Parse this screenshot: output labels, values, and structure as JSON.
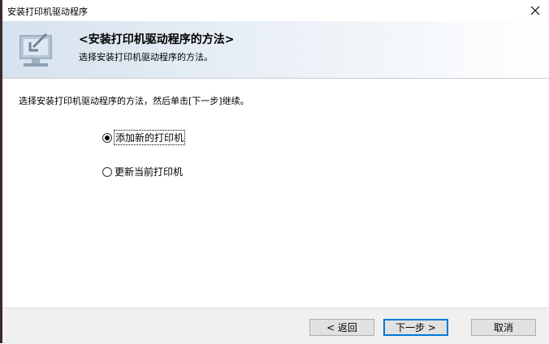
{
  "window": {
    "title": "安装打印机驱动程序"
  },
  "header": {
    "title": "<安装打印机驱动程序的方法>",
    "subtitle": "选择安装打印机驱动程序的方法。"
  },
  "main": {
    "instruction": "选择安装打印机驱动程序的方法，然后单击[下一步]继续。",
    "options": [
      {
        "label": "添加新的打印机",
        "selected": true
      },
      {
        "label": "更新当前打印机",
        "selected": false
      }
    ]
  },
  "footer": {
    "back_label": "< 返回",
    "next_label": "下一步 >",
    "cancel_label": "取消"
  },
  "icons": {
    "close": "close-icon",
    "header": "computer-arrow-icon"
  }
}
